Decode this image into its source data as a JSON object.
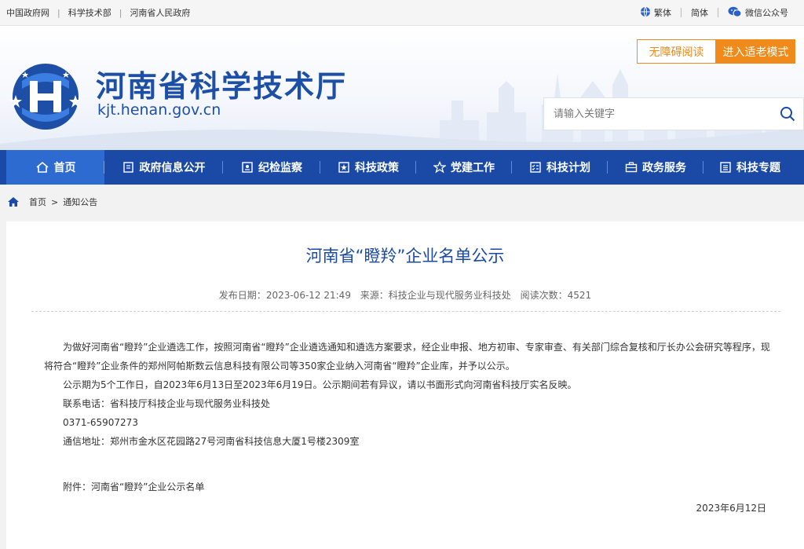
{
  "topbar": {
    "links": [
      "中国政府网",
      "科学技术部",
      "河南省人民政府"
    ],
    "traditional": "繁体",
    "simplified": "简体",
    "wechat": "微信公众号"
  },
  "header": {
    "title": "河南省科学技术厅",
    "domain": "kjt.henan.gov.cn",
    "accessible_btn": "无障碍阅读",
    "elder_btn": "进入适老模式",
    "search_placeholder": "请输入关键字"
  },
  "nav": {
    "items": [
      {
        "label": "首页",
        "icon": "home-icon"
      },
      {
        "label": "政府信息公开",
        "icon": "document-icon"
      },
      {
        "label": "纪检监察",
        "icon": "badge-icon"
      },
      {
        "label": "科技政策",
        "icon": "star-box-icon"
      },
      {
        "label": "党建工作",
        "icon": "star-icon"
      },
      {
        "label": "科技计划",
        "icon": "checklist-icon"
      },
      {
        "label": "政务服务",
        "icon": "briefcase-icon"
      },
      {
        "label": "科技专题",
        "icon": "list-icon"
      }
    ]
  },
  "breadcrumb": {
    "home": "首页",
    "separator": ">",
    "current": "通知公告"
  },
  "article": {
    "title": "河南省“瞪羚”企业名单公示",
    "date_label": "发布日期：",
    "date": "2023-06-12 21:49",
    "source_label": "来源：",
    "source": "科技企业与现代服务业科技处",
    "views_label": "阅读次数：",
    "views": "4521",
    "paragraph1": "为做好河南省“瞪羚”企业遴选工作，按照河南省“瞪羚”企业遴选通知和遴选方案要求，经企业申报、地方初审、专家审查、有关部门综合复核和厅长办公会研究等程序，现将符合“瞪羚”企业条件的郑州阿帕斯数云信息科技有限公司等350家企业纳入河南省“瞪羚”企业库，并予以公示。",
    "paragraph2": "公示期为5个工作日，自2023年6月13日至2023年6月19日。公示期间若有异议，请以书面形式向河南省科技厅实名反映。",
    "contact": "联系电话：省科技厅科技企业与现代服务业科技处",
    "phone": "0371-65907273",
    "address": "通信地址：郑州市金水区花园路27号河南省科技信息大厦1号楼2309室",
    "attachment": "附件：河南省“瞪羚”企业公示名单",
    "sign_date": "2023年6月12日"
  },
  "colors": {
    "brand_blue": "#1b4aa6",
    "active_nav": "#2e6bd0",
    "orange": "#f08a1b"
  }
}
